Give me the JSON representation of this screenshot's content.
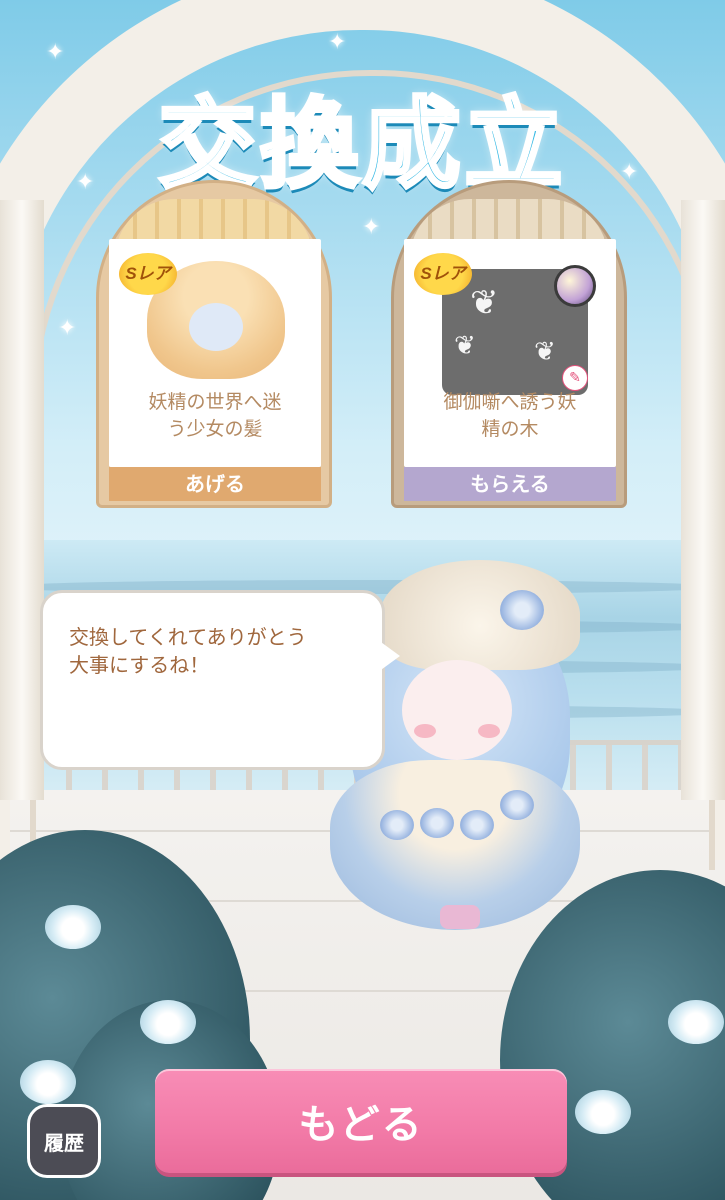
{
  "title": "交換成立",
  "give_card": {
    "rarity": "Sレア",
    "item_name": "妖精の世界へ迷\nう少女の髪",
    "label": "あげる"
  },
  "receive_card": {
    "rarity": "Sレア",
    "item_name": "御伽噺へ誘う妖\n精の木",
    "label": "もらえる"
  },
  "speech": {
    "text": "交換してくれてありがとう\n大事にするね！"
  },
  "buttons": {
    "back": "もどる",
    "history": "履歴"
  },
  "colors": {
    "title": "#31b7e3",
    "back_button": "#f27aa7",
    "give_label": "#e0a96f",
    "receive_label": "#b4a7cf",
    "item_text": "#b48a62"
  }
}
